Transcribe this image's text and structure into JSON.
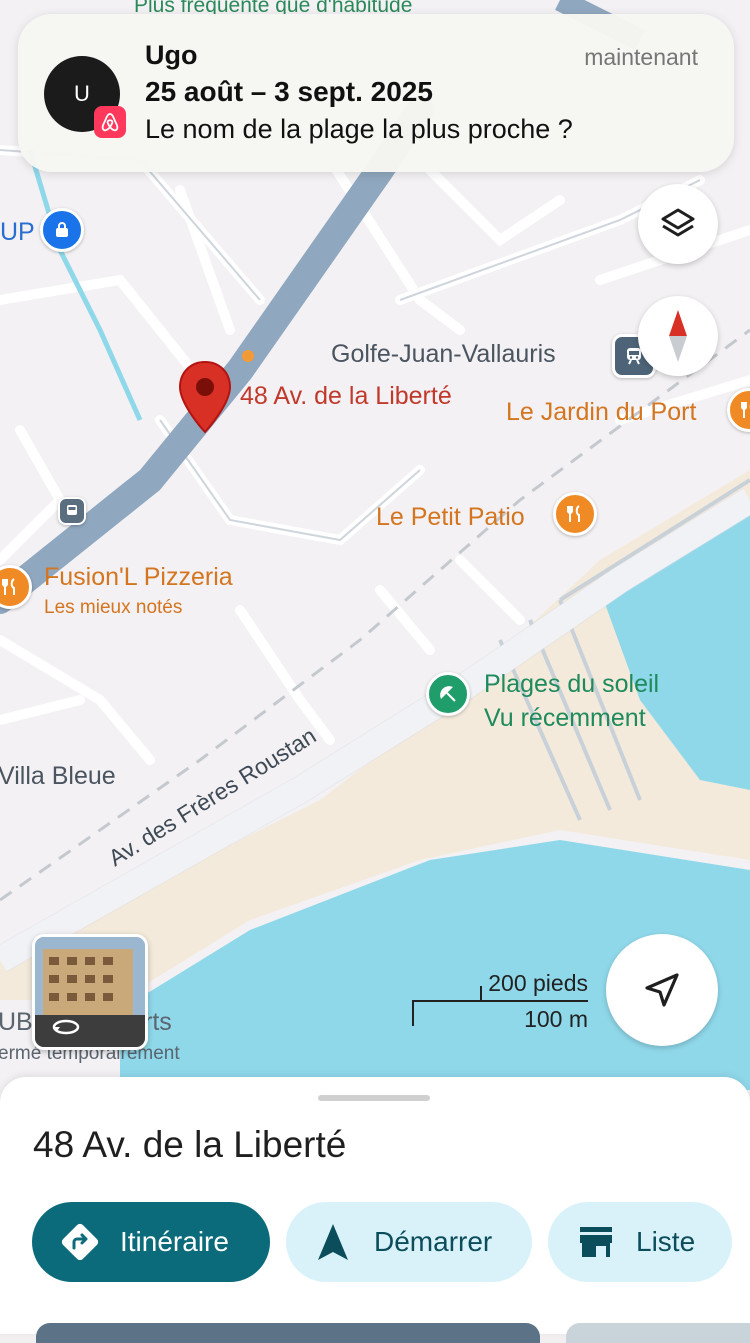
{
  "notification": {
    "avatar_initial": "U",
    "sender": "Ugo",
    "time": "maintenant",
    "dates": "25 août – 3 sept. 2025",
    "message": "Le nom de la plage la plus proche ?",
    "app_icon": "airbnb-logo"
  },
  "map": {
    "top_partial_label": "Plus fréquenté que d'habitude",
    "left_partial_label": "UP",
    "pin_label": "48 Av. de la Liberté",
    "station_label": "Golfe-Juan-Vallauris",
    "pois": [
      {
        "name": "Le Jardin du Port",
        "icon": "restaurant-icon"
      },
      {
        "name": "Le Petit Patio",
        "icon": "restaurant-icon"
      },
      {
        "name": "Fusion'L Pizzeria",
        "sub": "Les mieux notés",
        "icon": "restaurant-icon"
      },
      {
        "name": "Plages du soleil",
        "sub": "Vu récemment",
        "icon": "beach-icon"
      }
    ],
    "villa_label": "Villa Bleue",
    "street_label": "Av. des Frères Roustan",
    "partial_business": "UB V",
    "partial_business_suffix": "rts",
    "partial_business_status": "ermé temporairement",
    "scale": {
      "feet": "200 pieds",
      "meters": "100 m"
    },
    "colors": {
      "water": "#8fd8ea",
      "road_main": "#8fa7bf",
      "sand": "#f3eadb",
      "pin": "#d93025"
    }
  },
  "sheet": {
    "title": "48 Av. de la Liberté",
    "buttons": {
      "directions": "Itinéraire",
      "start": "Démarrer",
      "list": "Liste"
    }
  }
}
